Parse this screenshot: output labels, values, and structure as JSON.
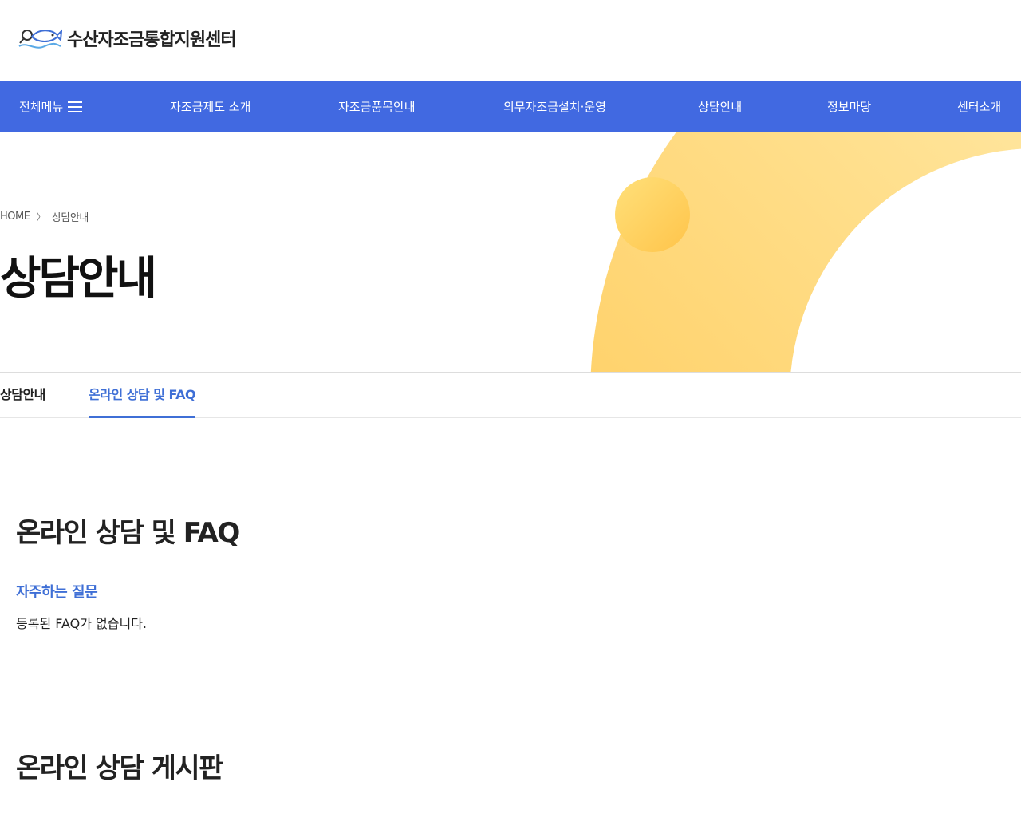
{
  "header": {
    "logo_text": "수산자조금통합지원센터",
    "logo_icon": "fish-logo-icon"
  },
  "gnb": {
    "all_menu_label": "전체메뉴",
    "all_menu_icon": "hamburger-menu-icon",
    "items": [
      {
        "label": "자조금제도 소개"
      },
      {
        "label": "자조금품목안내"
      },
      {
        "label": "의무자조금설치·운영"
      },
      {
        "label": "상담안내"
      },
      {
        "label": "정보마당"
      },
      {
        "label": "센터소개"
      }
    ],
    "bg_color": "#4169e1"
  },
  "visual": {
    "breadcrumb": {
      "home": "HOME",
      "separator": "〉",
      "current": "상담안내"
    },
    "title": "상담안내",
    "accent_colors": [
      "#ffc64d",
      "#fff3c0"
    ]
  },
  "tabs": {
    "items": [
      {
        "label": "상담안내",
        "active": false
      },
      {
        "label": "온라인 상담 및 FAQ",
        "active": true
      }
    ],
    "active_color": "#3f6fd6"
  },
  "content": {
    "faq_section_title": "온라인 상담 및 FAQ",
    "faq_heading": "자주하는 질문",
    "faq_empty_message": "등록된 FAQ가 없습니다.",
    "board_section_title": "온라인 상담 게시판"
  }
}
